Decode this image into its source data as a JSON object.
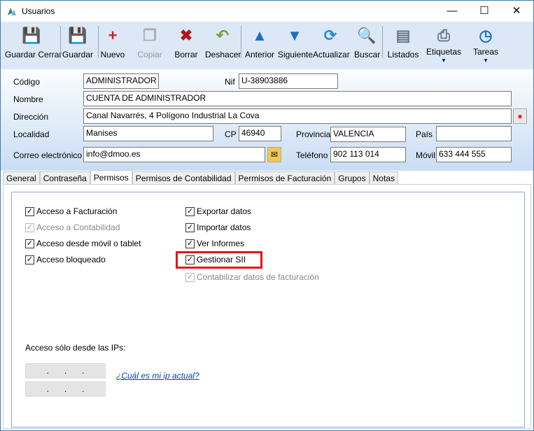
{
  "window": {
    "title": "Usuarios",
    "min": "—",
    "max": "☐",
    "close": "✕"
  },
  "toolbar": [
    {
      "label": "Guardar Cerrar",
      "icon": "save-close-icon",
      "color": "#1d5fa8",
      "enabled": true
    },
    {
      "label": "Guardar",
      "icon": "save-icon",
      "color": "#1d5fa8",
      "enabled": true
    },
    {
      "label": "Nuevo",
      "icon": "new-icon",
      "color": "#c8222a",
      "enabled": true
    },
    {
      "label": "Copiar",
      "icon": "copy-icon",
      "color": "#aaaaaa",
      "enabled": false
    },
    {
      "label": "Borrar",
      "icon": "delete-icon",
      "color": "#b01818",
      "enabled": true
    },
    {
      "label": "Deshacer",
      "icon": "undo-icon",
      "color": "#7aa436",
      "enabled": true
    },
    {
      "label": "Anterior",
      "icon": "up-arrow-icon",
      "color": "#1c6fc0",
      "enabled": true
    },
    {
      "label": "Siguiente",
      "icon": "down-arrow-icon",
      "color": "#1c6fc0",
      "enabled": true
    },
    {
      "label": "Actualizar",
      "icon": "refresh-icon",
      "color": "#2a8ad8",
      "enabled": true
    },
    {
      "label": "Buscar",
      "icon": "search-icon",
      "color": "#8899aa",
      "enabled": true
    },
    {
      "label": "Listados",
      "icon": "reports-icon",
      "color": "#667788",
      "enabled": true
    },
    {
      "label": "Etiquetas",
      "icon": "printer-icon",
      "color": "#667788",
      "enabled": true,
      "dropdown": "▾"
    },
    {
      "label": "Tareas",
      "icon": "clock-icon",
      "color": "#1c6fc0",
      "enabled": true,
      "dropdown": "▾"
    }
  ],
  "form": {
    "codigo_label": "Código",
    "codigo": "ADMINISTRADOR",
    "nif_label": "Nif",
    "nif": "U-38903886",
    "nombre_label": "Nombre",
    "nombre": "CUENTA DE ADMINISTRADOR",
    "direccion_label": "Dirección",
    "direccion": "Canal Navarrés, 4 Polígono Industrial La Cova",
    "localidad_label": "Localidad",
    "localidad": "Manises",
    "cp_label": "CP",
    "cp": "46940",
    "provincia_label": "Provincia",
    "provincia": "VALENCIA",
    "pais_label": "País",
    "pais": "",
    "correo_label": "Correo electrónico",
    "correo": "info@dmoo.es",
    "telefono_label": "Teléfono",
    "telefono": "902 113 014",
    "movil_label": "Móvil",
    "movil": "633 444 555"
  },
  "tabs": [
    "General",
    "Contraseña",
    "Permisos",
    "Permisos de Contabilidad",
    "Permisos de Facturación",
    "Grupos",
    "Notas"
  ],
  "active_tab": "Permisos",
  "permisos": {
    "col1": [
      {
        "label": "Acceso a Facturación",
        "checked": true,
        "enabled": true
      },
      {
        "label": "Acceso a Contabilidad",
        "checked": true,
        "enabled": false
      },
      {
        "label": "Acceso desde móvil o tablet",
        "checked": true,
        "enabled": true
      },
      {
        "label": "Acceso bloqueado",
        "checked": true,
        "enabled": true
      }
    ],
    "col2": [
      {
        "label": "Exportar datos",
        "checked": true,
        "enabled": true
      },
      {
        "label": "Importar datos",
        "checked": true,
        "enabled": true
      },
      {
        "label": "Ver Informes",
        "checked": true,
        "enabled": true
      },
      {
        "label": "Gestionar SII",
        "checked": true,
        "enabled": true
      },
      {
        "label": "Contabilizar datos de facturación",
        "checked": true,
        "enabled": false
      }
    ],
    "ips_label": "Acceso sólo desde las IPs:",
    "ip1": "...",
    "ip2": "...",
    "ip_link": "¿Cuál es mi ip actual?",
    "highlight_color": "#e8141c"
  }
}
